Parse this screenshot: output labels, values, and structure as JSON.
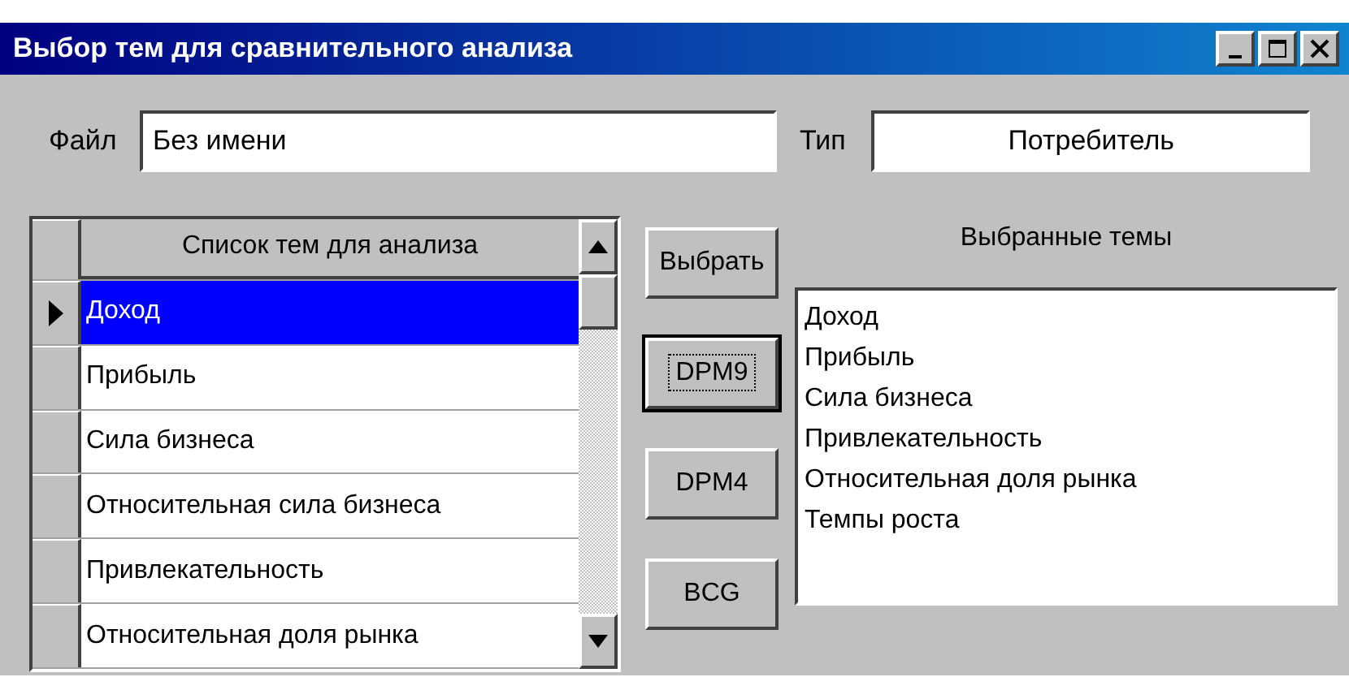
{
  "window": {
    "title": "Выбор тем для сравнительного анализа"
  },
  "file": {
    "label": "Файл",
    "value": "Без имени"
  },
  "type": {
    "label": "Тип",
    "value": "Потребитель"
  },
  "grid": {
    "column": "Список тем для анализа",
    "rows": [
      {
        "text": "Доход",
        "selected": true
      },
      {
        "text": "Прибыль",
        "selected": false
      },
      {
        "text": "Сила бизнеса",
        "selected": false
      },
      {
        "text": "Относительная сила бизнеса",
        "selected": false
      },
      {
        "text": "Привлекательность",
        "selected": false
      },
      {
        "text": "Относительная доля рынка",
        "selected": false
      }
    ]
  },
  "buttons": [
    {
      "label": "Выбрать",
      "focused": false
    },
    {
      "label": "DPM9",
      "focused": true
    },
    {
      "label": "DPM4",
      "focused": false
    },
    {
      "label": "BCG",
      "focused": false
    }
  ],
  "selected_topics": {
    "title": "Выбранные темы",
    "items": [
      "Доход",
      "Прибыль",
      "Сила бизнеса",
      "Привлекательность",
      "Относительная доля рынка",
      "Темпы роста"
    ]
  }
}
